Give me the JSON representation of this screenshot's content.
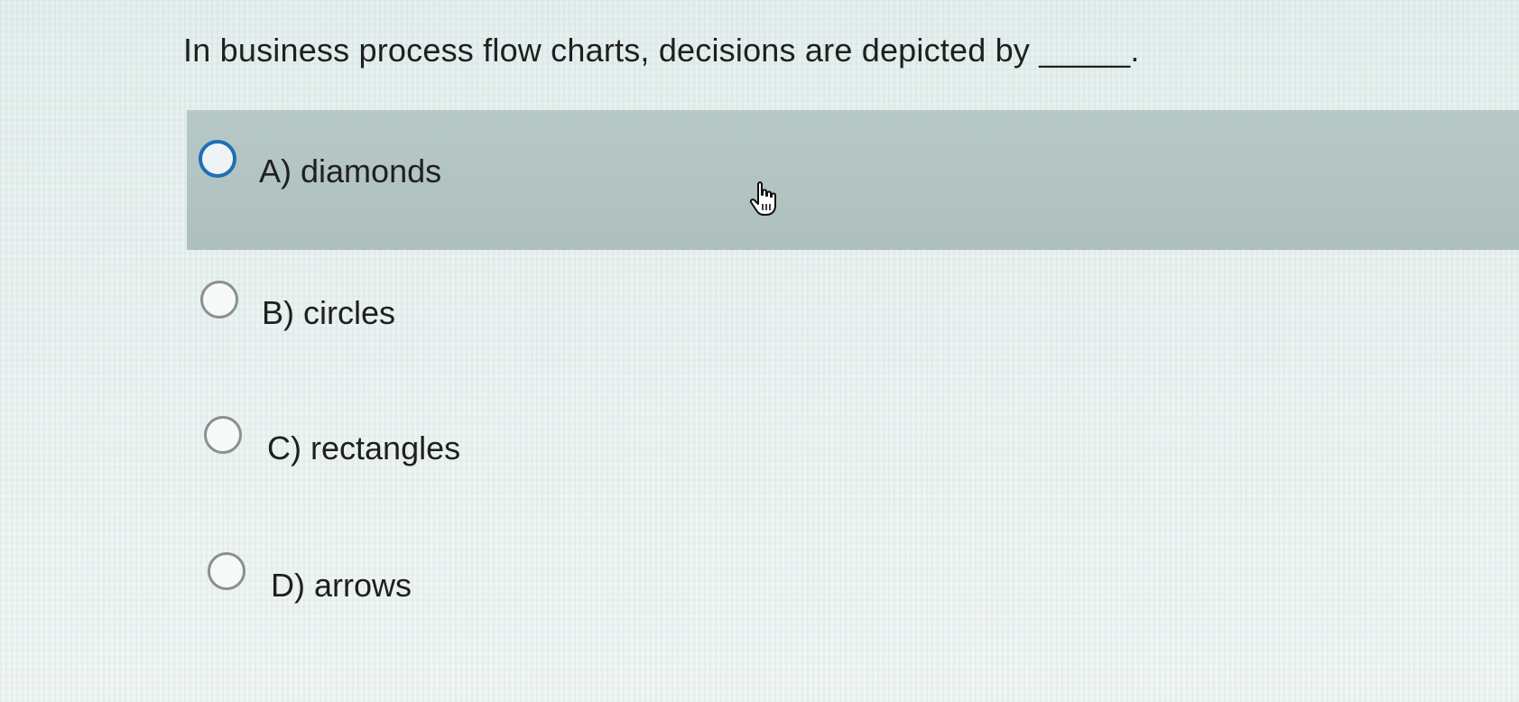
{
  "question": {
    "text": "In business process flow charts, decisions are depicted by _____."
  },
  "options": [
    {
      "label": "A)",
      "text": "diamonds",
      "hovered": true
    },
    {
      "label": "B)",
      "text": "circles",
      "hovered": false
    },
    {
      "label": "C)",
      "text": "rectangles",
      "hovered": false
    },
    {
      "label": "D)",
      "text": "arrows",
      "hovered": false
    }
  ],
  "colors": {
    "highlight": "#aebfbd",
    "focus_ring": "#1f6fb5",
    "radio_border": "#8a8f90"
  },
  "cursor": {
    "icon": "hand-pointer-icon"
  }
}
